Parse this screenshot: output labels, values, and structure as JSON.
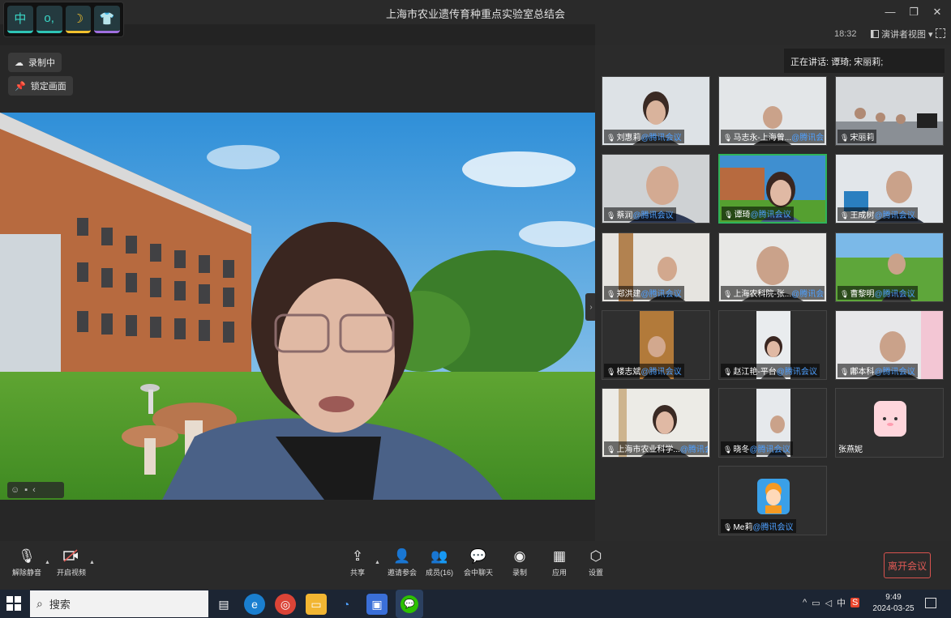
{
  "window": {
    "title": "上海市农业遗传育种重点实验室总结会",
    "minimize_glyph": "—",
    "restore_glyph": "❐",
    "close_glyph": "✕"
  },
  "ime": {
    "buttons": [
      "中",
      "o,",
      "☽",
      "👕"
    ]
  },
  "header": {
    "clock": "18:32",
    "view_label": "演讲者视图",
    "view_caret": "▾"
  },
  "stage": {
    "recording_label": "录制中",
    "lock_label": "锁定画面",
    "side_toggle": "›",
    "bottom_tools": [
      "☺",
      "▪",
      "‹"
    ]
  },
  "speaking": {
    "text": "正在讲话: 谭琦; 宋丽莉;"
  },
  "tiles": [
    {
      "name": "刘惠莉",
      "tag": "@腾讯会议",
      "muted": true
    },
    {
      "name": "马志永-上海曾...",
      "tag": "@腾讯会议",
      "muted": false
    },
    {
      "name": "宋丽莉",
      "tag": "",
      "muted": false
    },
    {
      "name": "蔡润",
      "tag": "@腾讯会议",
      "muted": false
    },
    {
      "name": "谭琦",
      "tag": "@腾讯会议",
      "muted": false
    },
    {
      "name": "王成树",
      "tag": "@腾讯会议",
      "muted": false
    },
    {
      "name": "郑洪建",
      "tag": "@腾讯会议",
      "muted": true
    },
    {
      "name": "上海农科院-张...",
      "tag": "@腾讯会议",
      "muted": true
    },
    {
      "name": "曹黎明",
      "tag": "@腾讯会议",
      "muted": true
    },
    {
      "name": "楼志斌",
      "tag": "@腾讯会议",
      "muted": false
    },
    {
      "name": "赵江艳-平台",
      "tag": "@腾讯会议",
      "muted": true
    },
    {
      "name": "鄘本科",
      "tag": "@腾讯会议",
      "muted": false
    },
    {
      "name": "上海市农业科学...",
      "tag": "@腾讯会议",
      "muted": true
    },
    {
      "name": "晓冬",
      "tag": "@腾讯会议",
      "muted": true
    },
    {
      "name": "张燕妮",
      "tag": "",
      "muted": false
    },
    {
      "name": "Me莉",
      "tag": "@腾讯会议",
      "muted": true
    }
  ],
  "toolbar": {
    "unmute": "解除静音",
    "video": "开启视频",
    "share": "共享",
    "invite": "邀请参会",
    "members": "成员(16)",
    "chat": "会中聊天",
    "record": "录制",
    "apps": "应用",
    "settings": "设置",
    "leave": "离开会议",
    "caret": "▲"
  },
  "taskbar": {
    "search_label": "搜索",
    "tray_ime": "中",
    "time": "9:49",
    "date": "2024-03-25"
  },
  "colors": {
    "accent_blue": "#4ea0ff",
    "active_green": "#2fb35a",
    "leave_red": "#e05a55"
  }
}
